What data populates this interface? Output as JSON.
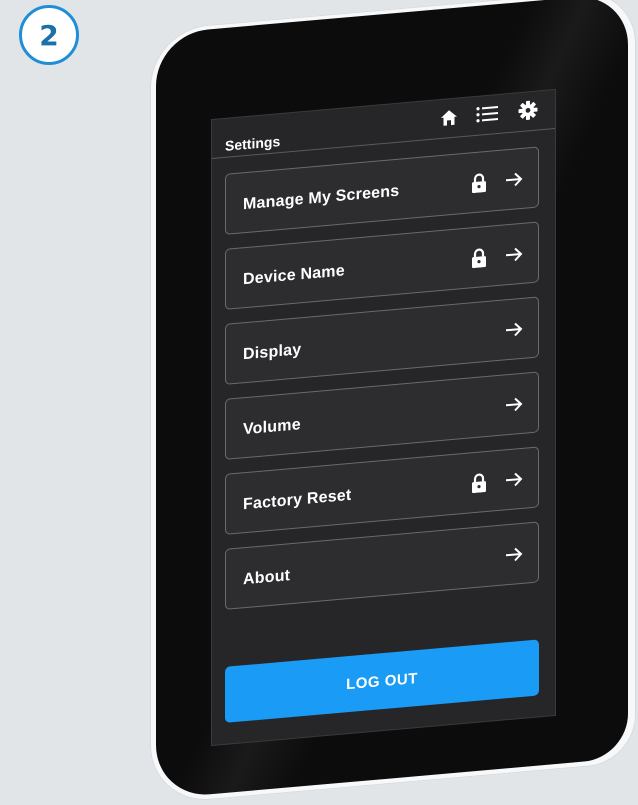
{
  "step": {
    "number": "2"
  },
  "header": {
    "title": "Settings",
    "icons": [
      "home-icon",
      "list-icon",
      "gear-icon"
    ]
  },
  "menu": {
    "items": [
      {
        "label": "Manage My Screens",
        "locked": true,
        "icon": "arrow-right-icon"
      },
      {
        "label": "Device Name",
        "locked": true,
        "icon": "arrow-right-icon"
      },
      {
        "label": "Display",
        "locked": false,
        "icon": "arrow-right-icon"
      },
      {
        "label": "Volume",
        "locked": false,
        "icon": "arrow-right-icon"
      },
      {
        "label": "Factory Reset",
        "locked": true,
        "icon": "arrow-right-icon"
      },
      {
        "label": "About",
        "locked": false,
        "icon": "arrow-right-icon"
      }
    ]
  },
  "logout": {
    "label": "LOG OUT"
  },
  "colors": {
    "accent": "#1a9bf5",
    "screen_bg": "#262628",
    "badge_border": "#1e8ed6"
  }
}
